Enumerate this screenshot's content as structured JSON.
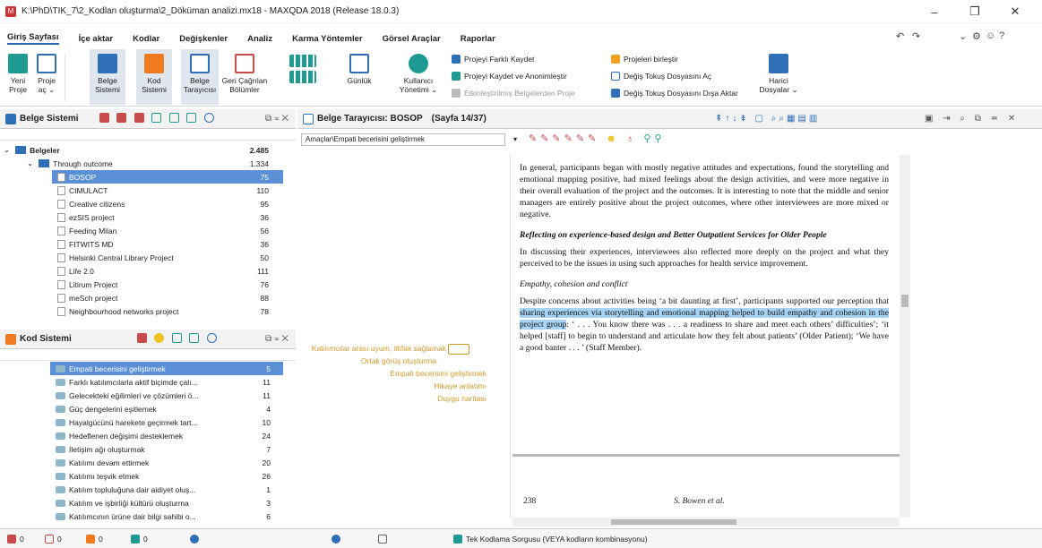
{
  "window": {
    "title": "K:\\PhD\\TIK_7\\2_Kodlan oluşturma\\2_Döküman analizi.mx18 - MAXQDA 2018 (Release 18.0.3)",
    "minimize": "–",
    "maximize": "❐",
    "close": "✕"
  },
  "menu": {
    "tabs": [
      "Giriş Sayfası",
      "İçe aktar",
      "Kodlar",
      "Değişkenler",
      "Analiz",
      "Karma Yöntemler",
      "Görsel Araçlar",
      "Raporlar"
    ]
  },
  "ribbon": {
    "yeni_proje": "Yeni\nProje",
    "proje_ac": "Proje\naç ⌄",
    "belge_sistemi": "Belge\nSistemi",
    "kod_sistemi": "Kod\nSistemi",
    "belge_tarayicisi": "Belge\nTarayıcısı",
    "geri_cagrilan": "Geri Çağrılan\nBölümler",
    "gunluk": "Günlük",
    "kullanici": "Kullanıcı\nYönetimi ⌄",
    "projeyi_farkli": "Projeyi Farklı Kaydet",
    "projeyi_anonim": "Projeyi Kaydet ve Anonimleştir",
    "etkinlestirilmis": "Etkinleştirilmiş Belgelerden Proje",
    "projeleri_birlestir": "Projeleri birleştir",
    "degis_tokus_ac": "Değiş Tokuş Dosyasını Aç",
    "degis_tokus_disa": "Değiş Tokuş Dosyasını Dışa Aktar",
    "harici": "Harici\nDosyalar ⌄"
  },
  "belge_sistemi": {
    "title": "Belge Sistemi",
    "rows": [
      {
        "label": "Belgeler",
        "count": "2.485",
        "bold": true
      },
      {
        "label": "Through outcome",
        "count": "1.334"
      },
      {
        "label": "BOSOP",
        "count": "75",
        "selected": true
      },
      {
        "label": "CIMULACT",
        "count": "110"
      },
      {
        "label": "Creative citizens",
        "count": "95"
      },
      {
        "label": "ezSIS project",
        "count": "36"
      },
      {
        "label": "Feeding Milan",
        "count": "56"
      },
      {
        "label": "FITWITS MD",
        "count": "36"
      },
      {
        "label": "Helsinki Central Library Project",
        "count": "50"
      },
      {
        "label": "Life 2.0",
        "count": "111"
      },
      {
        "label": "Litirum Project",
        "count": "76"
      },
      {
        "label": "meSch project",
        "count": "88"
      },
      {
        "label": "Neighbourhood networks project",
        "count": "78"
      }
    ]
  },
  "kod_sistemi": {
    "title": "Kod Sistemi",
    "rows": [
      {
        "label": "Empati becerisini geliştirmek",
        "count": "5",
        "selected": true
      },
      {
        "label": "Farklı katılımcılarla aktif biçimde çalı...",
        "count": "11"
      },
      {
        "label": "Gelecekteki eğilimleri ve çözümleri ö...",
        "count": "11"
      },
      {
        "label": "Güç dengelerini eşitlemek",
        "count": "4"
      },
      {
        "label": "Hayalgücünü harekete geçirmek tart...",
        "count": "10"
      },
      {
        "label": "Hedeflenen değişimi desteklemek",
        "count": "24"
      },
      {
        "label": "İletişim ağı oluşturmak",
        "count": "7"
      },
      {
        "label": "Katılımı devam ettirmek",
        "count": "20"
      },
      {
        "label": "Katılımı teşvik etmek",
        "count": "26"
      },
      {
        "label": "Katılım topluluğuna dair aidiyet oluş...",
        "count": "1"
      },
      {
        "label": "Katılım ve işbirliği kültürü oluşturma",
        "count": "3"
      },
      {
        "label": "Katılımcının ürüne dair bilgi sahibi o...",
        "count": "6"
      }
    ]
  },
  "browser": {
    "title": "Belge Tarayıcısı: BOSOP",
    "page": "(Sayfa 14/37)",
    "code_select": "Amaçlar\\Empati becerisini geliştirmek",
    "codes": [
      "Katılımcılar arası uyum, ittifak sağlamak",
      "Ortak görüş oluşturma",
      "Empati becerisini geliştirmek",
      "Hikaye anlatımı",
      "Duygu haritası"
    ],
    "para1": "In general, participants began with mostly negative attitudes and expectations, found the storytelling and emotional mapping positive, had mixed feelings about the design activities, and were more negative in their overall evaluation of the project and the outcomes. It is interesting to note that the middle and senior managers are entirely positive about the project outcomes, where other interviewees are more mixed or negative.",
    "heading1": "Reflecting on experience-based design and Better Outpatient Services for Older People",
    "para2": "In discussing their experiences, interviewees also reflected more deeply on the project and what they perceived to be the issues in using such approaches for health service improvement.",
    "heading2": "Empathy, cohesion and conflict",
    "para3_pre": "Despite concerns about activities being ‘a bit daunting at first’, participants supported our perception that ",
    "para3_mark": "sharing experiences via storytelling and emotional mapping helped to build empathy and cohesion in the project group",
    "para3_post": ": ‘ . . . You know there was . . . a readiness to share and meet each others’ difficulties’; ‘it helped [staff] to begin to understand and articulate how they felt about patients’ (Older Patient); ‘We have a good banter . . . ’ (Staff Member).",
    "footer_page": "238",
    "footer_author": "S. Bowen et al."
  },
  "status": {
    "s1": "0",
    "s2": "0",
    "s3": "0",
    "s4": "0",
    "query": "Tek Kodlama Sorgusu (VEYA kodların kombinasyonu)"
  },
  "colors": {
    "accent": "#2e6fb7",
    "selection": "#5b8fd6",
    "highlight": "#a7d3f4",
    "code_orange": "#f07a1f"
  }
}
